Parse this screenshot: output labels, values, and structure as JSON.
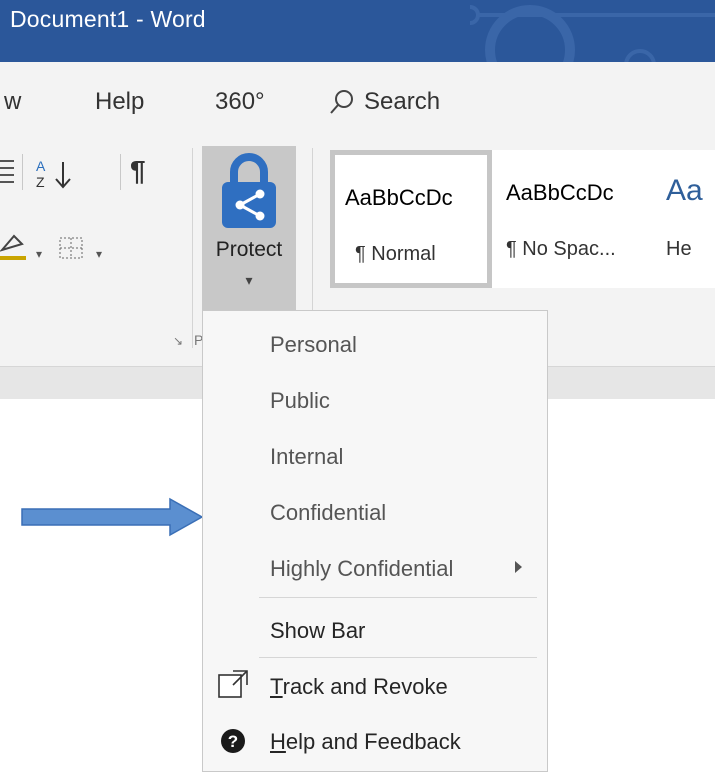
{
  "window": {
    "title": "Document1  -  Word"
  },
  "tabs": {
    "view_partial": "w",
    "help": "Help",
    "tab_360": "360°",
    "search": "Search"
  },
  "ribbon": {
    "sort_glyph_top": "A",
    "sort_glyph_bottom": "Z",
    "paragraph_mark": "¶",
    "protect": {
      "label": "Protect",
      "dropdown_arrow": "▾"
    },
    "styles": [
      {
        "sample": "AaBbCcDc",
        "name": "¶ Normal"
      },
      {
        "sample": "AaBbCcDc",
        "name": "¶ No Spac..."
      },
      {
        "sample": "Aa",
        "name": "He"
      }
    ],
    "dialog_launcher": "↘",
    "group_label_partial": "P"
  },
  "protect_menu": {
    "items": [
      {
        "label": "Personal"
      },
      {
        "label": "Public"
      },
      {
        "label": "Internal"
      },
      {
        "label": "Confidential"
      },
      {
        "label": "Highly Confidential"
      }
    ],
    "show_bar": "Show Bar",
    "track_revoke": {
      "first": "T",
      "rest": "rack and Revoke"
    },
    "help_feedback": {
      "first": "H",
      "rest": "elp and Feedback"
    }
  },
  "colors": {
    "titlebar": "#2b579a",
    "ribbon": "#f3f3f3",
    "protect_icon": "#2f6fc1",
    "callout_arrow": "#5b8fd0"
  }
}
